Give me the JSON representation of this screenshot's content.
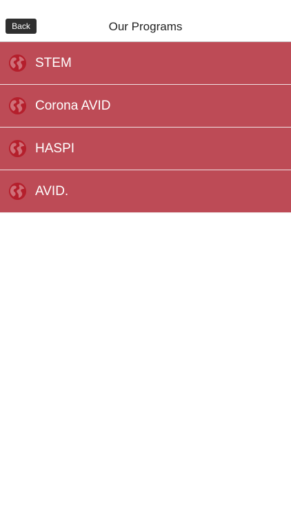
{
  "nav": {
    "back_label": "Back",
    "title": "Our Programs"
  },
  "colors": {
    "row_background": "#bd4b56",
    "icon_color": "#b51f2c",
    "back_button_background": "#2f2f2f"
  },
  "programs": [
    {
      "label": "STEM",
      "icon": "globe-icon"
    },
    {
      "label": "Corona AVID",
      "icon": "globe-icon"
    },
    {
      "label": "HASPI",
      "icon": "globe-icon"
    },
    {
      "label": "AVID.",
      "icon": "globe-icon"
    }
  ]
}
